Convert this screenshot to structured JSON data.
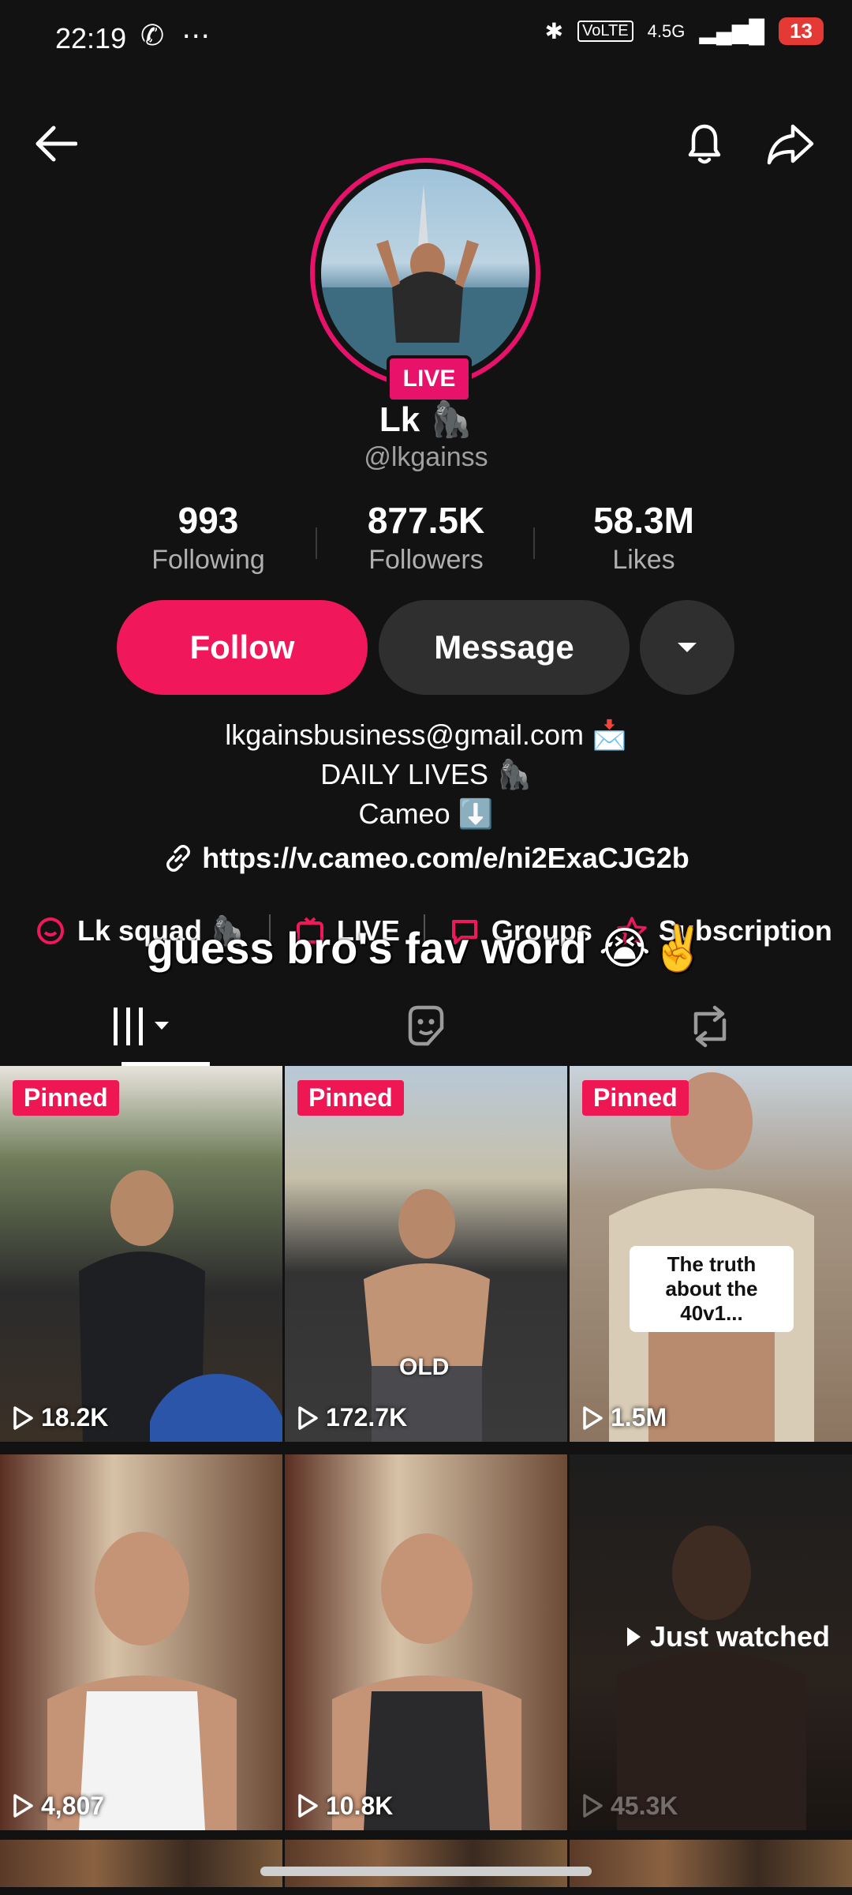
{
  "status_bar": {
    "time": "22:19",
    "network": "4.5G",
    "battery": "13"
  },
  "profile": {
    "name": "Lk 🦍",
    "handle": "@lkgainss",
    "live_badge": "LIVE"
  },
  "stats": [
    {
      "value": "993",
      "label": "Following"
    },
    {
      "value": "877.5K",
      "label": "Followers"
    },
    {
      "value": "58.3M",
      "label": "Likes"
    }
  ],
  "actions": {
    "follow": "Follow",
    "message": "Message"
  },
  "bio": {
    "line1": "lkgainsbusiness@gmail.com 📩",
    "line2": "DAILY LIVES 🦍",
    "line3": "Cameo ⬇️",
    "link": "https://v.cameo.com/e/ni2ExaCJG2b"
  },
  "chips": [
    "Lk squad 🦍",
    "LIVE",
    "Groups",
    "Subscription"
  ],
  "caption": "guess bro's fav word 😭✌️",
  "videos": [
    {
      "pinned": "Pinned",
      "views": "18.2K"
    },
    {
      "pinned": "Pinned",
      "views": "172.7K",
      "overlay": "OLD"
    },
    {
      "pinned": "Pinned",
      "views": "1.5M",
      "overlay": "The truth about the 40v1..."
    },
    {
      "views": "4,807"
    },
    {
      "views": "10.8K"
    },
    {
      "views": "45.3K",
      "badge": "Just watched"
    }
  ]
}
